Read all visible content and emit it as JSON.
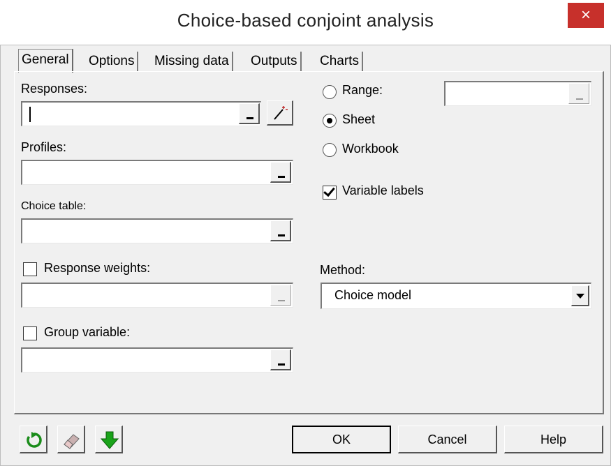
{
  "window": {
    "title": "Choice-based conjoint analysis",
    "close_glyph": "×"
  },
  "tabs": [
    {
      "label": "General",
      "active": true
    },
    {
      "label": "Options",
      "active": false
    },
    {
      "label": "Missing data",
      "active": false
    },
    {
      "label": "Outputs",
      "active": false
    },
    {
      "label": "Charts",
      "active": false
    }
  ],
  "general": {
    "responses_label": "Responses:",
    "responses_value": "",
    "profiles_label": "Profiles:",
    "profiles_value": "",
    "choice_table_label": "Choice table:",
    "choice_table_value": "",
    "response_weights_label": "Response weights:",
    "response_weights_checked": false,
    "response_weights_value": "",
    "group_variable_label": "Group variable:",
    "group_variable_checked": false,
    "group_variable_value": "",
    "output": {
      "range_label": "Range:",
      "sheet_label": "Sheet",
      "workbook_label": "Workbook",
      "selected": "Sheet",
      "range_value": ""
    },
    "variable_labels_label": "Variable labels",
    "variable_labels_checked": true,
    "method_label": "Method:",
    "method_value": "Choice model"
  },
  "footer": {
    "ok_label": "OK",
    "cancel_label": "Cancel",
    "help_label": "Help",
    "icons": [
      "reset-icon",
      "eraser-icon",
      "down-arrow-icon"
    ]
  },
  "colors": {
    "close_button": "#c7302b",
    "reset_icon": "#1a8c1a",
    "down_arrow": "#1aa31a"
  }
}
